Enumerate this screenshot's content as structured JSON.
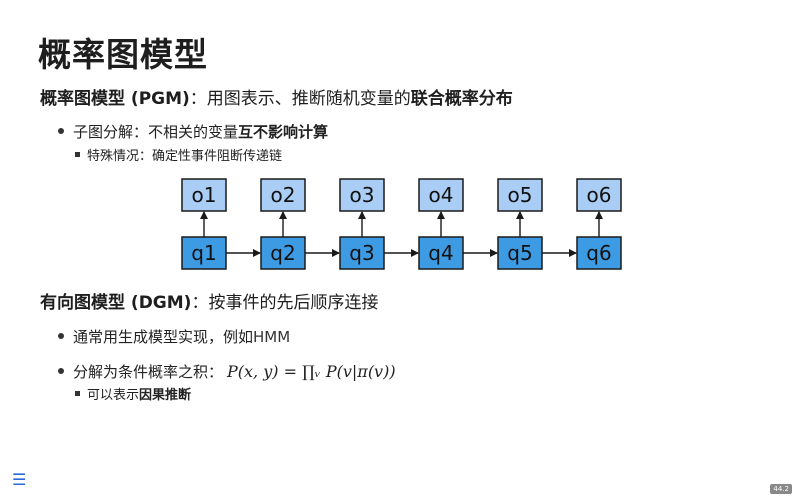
{
  "slide": {
    "title": "概率图模型",
    "page_number": "44.2"
  },
  "pgm": {
    "heading_bold": "概率图模型 (PGM)",
    "heading_rest": "：用图表示、推断随机变量的",
    "heading_tail_bold": "联合概率分布",
    "bullet1_text": "子图分解：不相关的变量",
    "bullet1_bold": "互不影响计算",
    "sub1": "特殊情况：确定性事件阻断传递链"
  },
  "diagram": {
    "observed": [
      "o1",
      "o2",
      "o3",
      "o4",
      "o5",
      "o6"
    ],
    "hidden": [
      "q1",
      "q2",
      "q3",
      "q4",
      "q5",
      "q6"
    ],
    "colors": {
      "observed_fill": "#a9cdf5",
      "hidden_fill": "#3d9be3",
      "stroke": "#1a1a1a"
    }
  },
  "dgm": {
    "heading_bold": "有向图模型 (DGM)",
    "heading_rest": "：按事件的先后顺序连接",
    "bullet1_text": "通常用生成模型实现，例如 ",
    "bullet1_hmm": "HMM",
    "bullet2_text": "分解为条件概率之积：",
    "bullet2_formula": "P(x, y) = ∏ᵥ P(v|π(v))",
    "sub1_text": "可以表示",
    "sub1_bold": "因果推断"
  },
  "nav": {
    "menu_icon": "☰"
  }
}
